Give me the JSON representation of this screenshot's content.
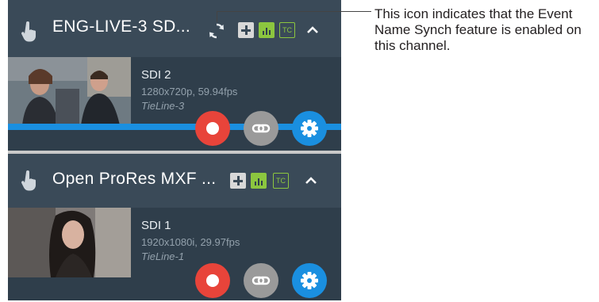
{
  "channels": [
    {
      "title": "ENG-LIVE-3 SD...",
      "source_name": "SDI 2",
      "resolution": "1280x720p, 59.94fps",
      "tieline": "TieLine-3",
      "tc_label": "TC",
      "sync_enabled": true,
      "thumbnail_icon": "video-thumbnail"
    },
    {
      "title": "Open ProRes MXF ...",
      "source_name": "SDI 1",
      "resolution": "1920x1080i, 29.97fps",
      "tieline": "TieLine-1",
      "tc_label": "TC",
      "sync_enabled": false,
      "thumbnail_icon": "video-thumbnail"
    }
  ],
  "callout": {
    "text": "This icon indicates that the Event Name Synch feature is enabled on this channel."
  },
  "colors": {
    "header_bg": "#3a4a58",
    "card_bg": "#2f3e4b",
    "record": "#e8443a",
    "link": "#9a9a9a",
    "settings": "#1a8fe0",
    "tc_green": "#8cc63f"
  }
}
